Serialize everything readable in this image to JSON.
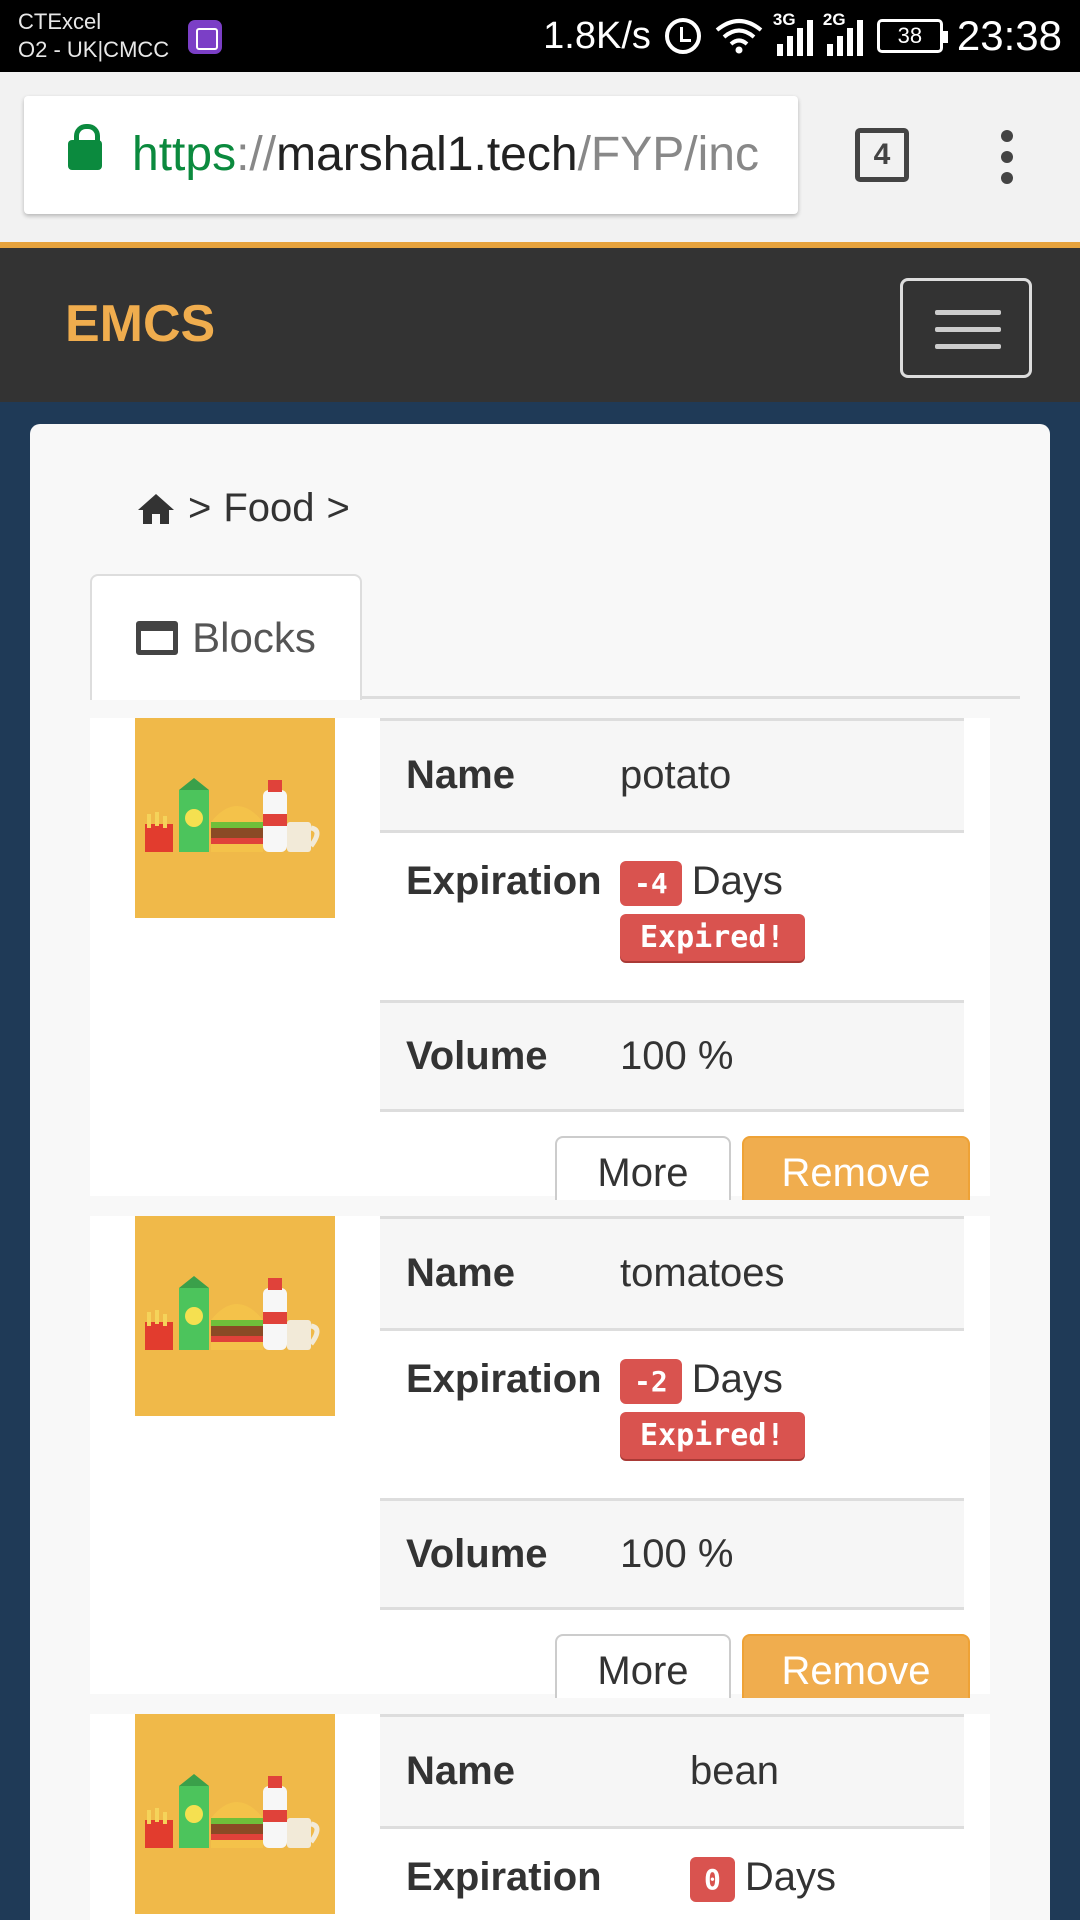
{
  "statusbar": {
    "carrier_line1": "CTExcel",
    "carrier_line2": "O2 - UK|CMCC",
    "speed": "1.8K/s",
    "net1": "3G",
    "net2": "2G",
    "battery": "38",
    "time": "23:38"
  },
  "browser": {
    "url_scheme": "https",
    "url_sep": "://",
    "url_host": "marshal1.tech",
    "url_path": "/FYP/inc",
    "tab_count": "4"
  },
  "nav": {
    "brand": "EMCS"
  },
  "breadcrumb": {
    "sep1": ">",
    "item": "Food",
    "sep2": ">"
  },
  "tab": {
    "label": "Blocks"
  },
  "labels": {
    "name": "Name",
    "expiration": "Expiration",
    "volume": "Volume",
    "days": "Days",
    "expired": "Expired!",
    "more": "More",
    "remove": "Remove"
  },
  "items": [
    {
      "name": "potato",
      "days": "-4",
      "volume": "100 %"
    },
    {
      "name": "tomatoes",
      "days": "-2",
      "volume": "100 %"
    },
    {
      "name": "bean",
      "days": "0"
    }
  ],
  "colors": {
    "brand": "#f0ad4e",
    "danger": "#d9534f",
    "nav_bg": "#333333",
    "page_bg": "#1f3a57"
  }
}
